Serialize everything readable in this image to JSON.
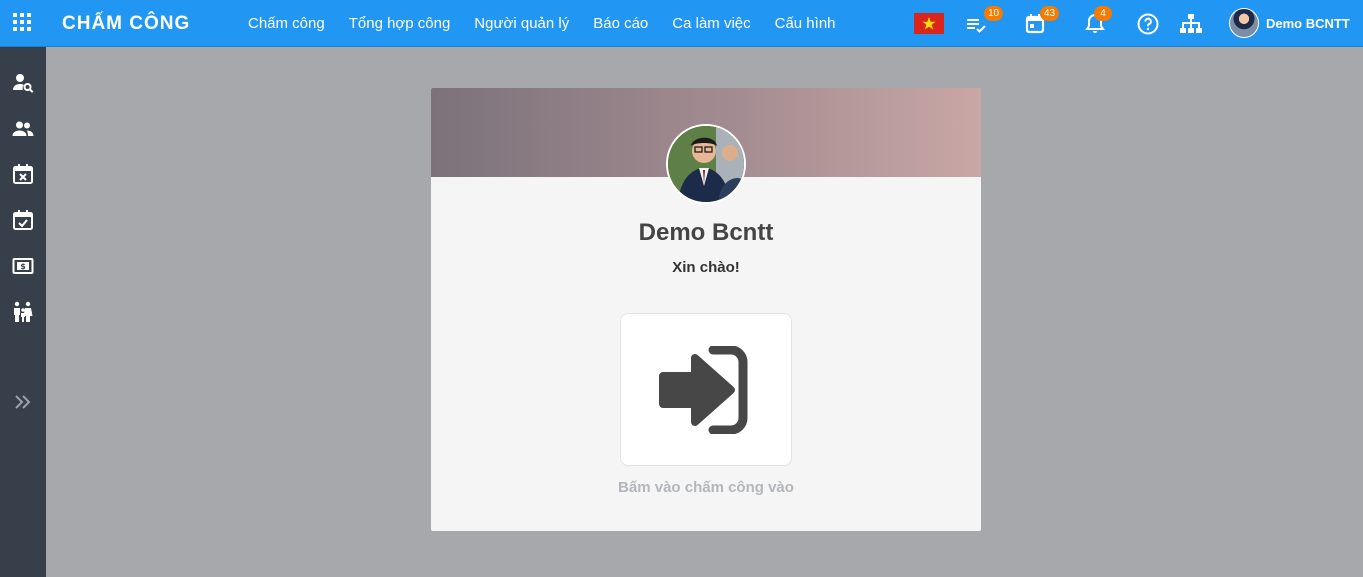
{
  "app": {
    "title": "CHẤM CÔNG"
  },
  "nav": {
    "items": [
      {
        "label": "Chấm công"
      },
      {
        "label": "Tổng hợp công"
      },
      {
        "label": "Người quản lý"
      },
      {
        "label": "Báo cáo"
      },
      {
        "label": "Ca làm việc"
      },
      {
        "label": "Cấu hình"
      }
    ]
  },
  "toolbar": {
    "language_icon": "vietnam-flag-icon",
    "tasks_badge": "10",
    "calendar_badge": "43",
    "notifications_badge": "4",
    "help_icon": "help-circle-icon",
    "org_icon": "org-chart-icon"
  },
  "user": {
    "name": "Demo BCNTT"
  },
  "sidebar": {
    "items": [
      {
        "icon": "user-search-icon"
      },
      {
        "icon": "users-icon"
      },
      {
        "icon": "calendar-cancel-icon"
      },
      {
        "icon": "calendar-check-icon"
      },
      {
        "icon": "money-icon"
      },
      {
        "icon": "family-icon"
      }
    ],
    "expand_icon": "double-chevron-right-icon"
  },
  "card": {
    "name": "Demo Bcntt",
    "greeting": "Xin chào!",
    "checkin_icon": "sign-in-icon",
    "checkin_caption": "Bấm vào chấm công vào"
  },
  "colors": {
    "topbar": "#2196f3",
    "sidebar": "#37404a",
    "background": "#a7a8ab",
    "badge": "#f57c00"
  }
}
